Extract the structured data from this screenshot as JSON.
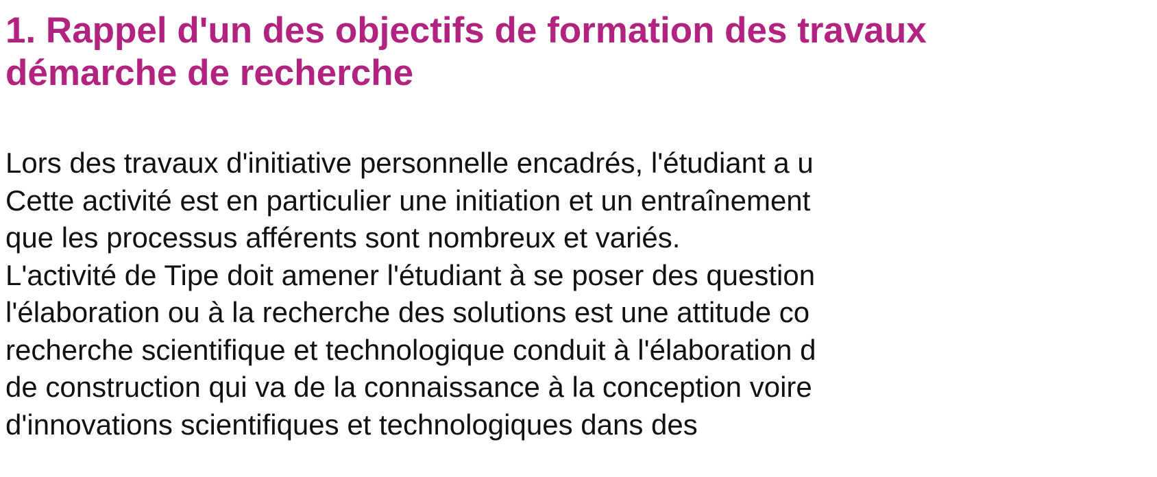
{
  "document": {
    "heading_lines": [
      "1. Rappel d'un des objectifs de formation des travaux",
      "démarche de recherche"
    ],
    "body_lines": [
      "Lors des travaux d'initiative personnelle encadrés, l'étudiant a u",
      "Cette activité est en particulier une initiation et un entraînement",
      "que les processus afférents sont nombreux et variés.",
      "L'activité de Tipe doit amener l'étudiant à se poser des question",
      "l'élaboration ou à la recherche des solutions est une attitude co",
      "recherche scientifique et technologique conduit à l'élaboration d",
      "de construction qui va de la connaissance à la conception voire",
      "d'innovations scientifiques et technologiques dans des"
    ],
    "colors": {
      "heading": "#b2237f",
      "body": "#111111",
      "background": "#ffffff"
    }
  }
}
